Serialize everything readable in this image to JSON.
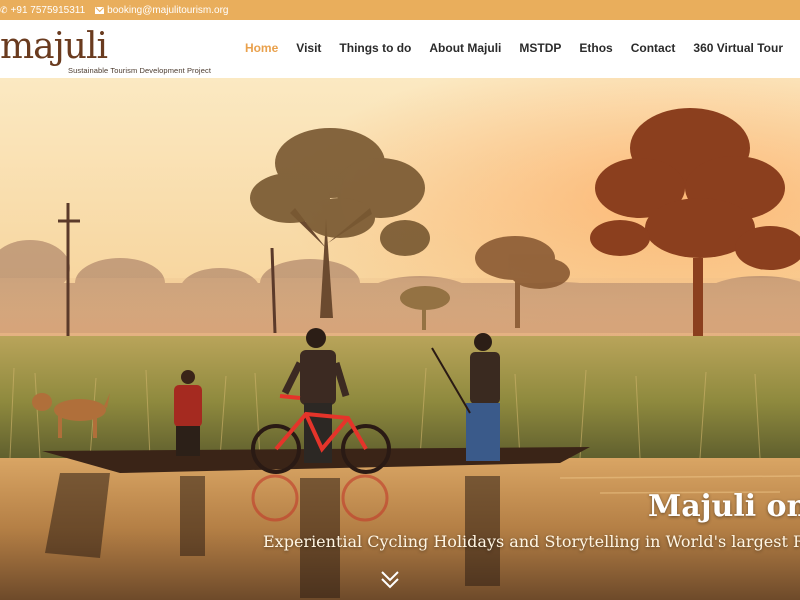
{
  "topbar": {
    "phone_icon": "phone-icon",
    "phone": "+91 7575915311",
    "email_icon": "envelope-icon",
    "email": "booking@majulitourism.org",
    "background_color": "#e9ae5c"
  },
  "header": {
    "logo_word": "majuli",
    "logo_tagline": "Sustainable Tourism Development Project",
    "nav": [
      {
        "label": "Home",
        "active": true
      },
      {
        "label": "Visit"
      },
      {
        "label": "Things to do"
      },
      {
        "label": "About Majuli"
      },
      {
        "label": "MSTDP"
      },
      {
        "label": "Ethos"
      },
      {
        "label": "Contact"
      },
      {
        "label": "360 Virtual Tour"
      }
    ],
    "active_color": "#e9a14d"
  },
  "hero": {
    "title": "Majuli on C",
    "subtitle": "Experiential Cycling Holidays and Storytelling in World's largest Ri",
    "scroll_icon": "double-chevron-down-icon"
  }
}
